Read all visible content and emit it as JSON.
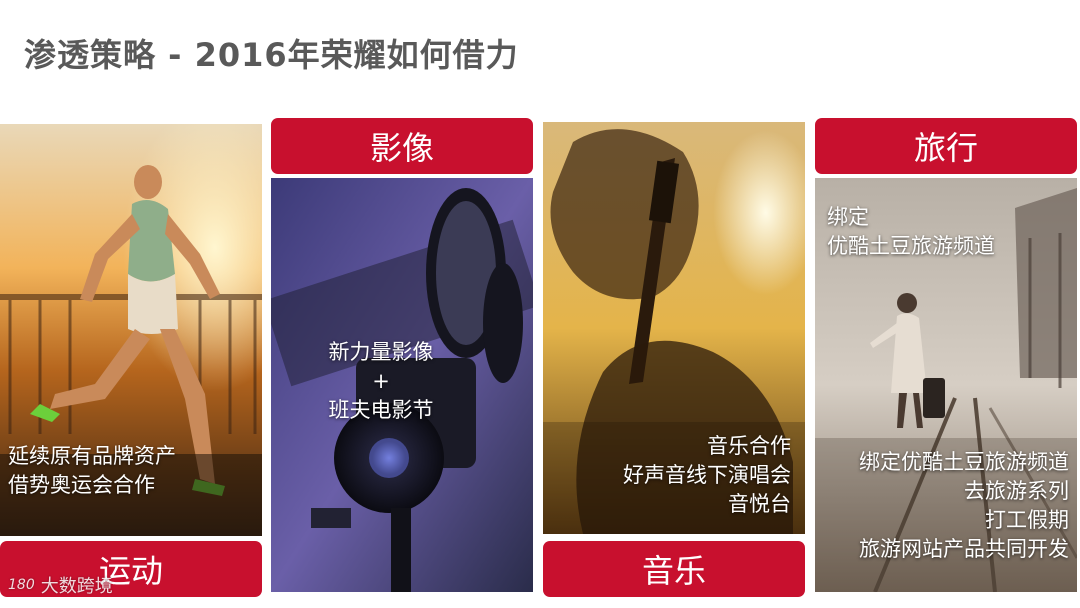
{
  "title": "渗透策略 - 2016年荣耀如何借力",
  "cards": {
    "sport": {
      "label": "运动",
      "lines": [
        "延续原有品牌资产",
        "借势奥运会合作"
      ]
    },
    "imaging": {
      "label": "影像",
      "lines": [
        "新力量影像",
        "+",
        "班夫电影节"
      ]
    },
    "music": {
      "label": "音乐",
      "lines": [
        "音乐合作",
        "好声音线下演唱会",
        "音悦台"
      ]
    },
    "travel": {
      "label": "旅行",
      "top_lines": [
        "绑定",
        "优酷土豆旅游频道"
      ],
      "bottom_lines": [
        "绑定优酷土豆旅游频道",
        "去旅游系列",
        "打工假期",
        "旅游网站产品共同开发"
      ]
    }
  },
  "watermark": {
    "logo": "180",
    "text": "大数跨境"
  },
  "colors": {
    "accent": "#c8102e",
    "title": "#595959"
  },
  "icons": [
    "runner-photo",
    "film-camera-photo",
    "guitar-silhouette-photo",
    "traveler-railway-photo"
  ]
}
